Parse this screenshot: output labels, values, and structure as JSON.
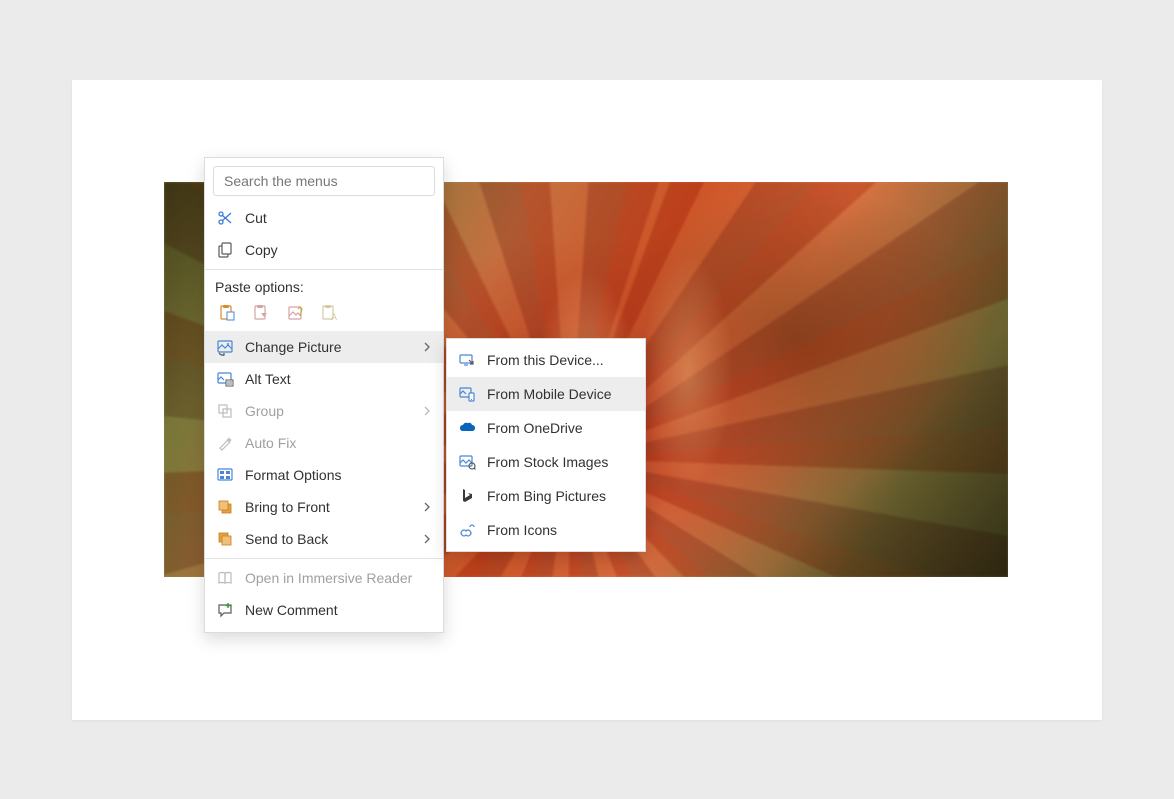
{
  "search": {
    "placeholder": "Search the menus"
  },
  "menu": {
    "cut": "Cut",
    "copy": "Copy",
    "paste_label": "Paste options:",
    "change_picture": "Change Picture",
    "alt_text": "Alt Text",
    "group": "Group",
    "auto_fix": "Auto Fix",
    "format_options": "Format Options",
    "bring_to_front": "Bring to Front",
    "send_to_back": "Send to Back",
    "immersive_reader": "Open in Immersive Reader",
    "new_comment": "New Comment"
  },
  "submenu": {
    "from_device": "From this Device...",
    "from_mobile": "From Mobile Device",
    "from_onedrive": "From OneDrive",
    "from_stock": "From Stock Images",
    "from_bing": "From Bing Pictures",
    "from_icons": "From Icons"
  }
}
